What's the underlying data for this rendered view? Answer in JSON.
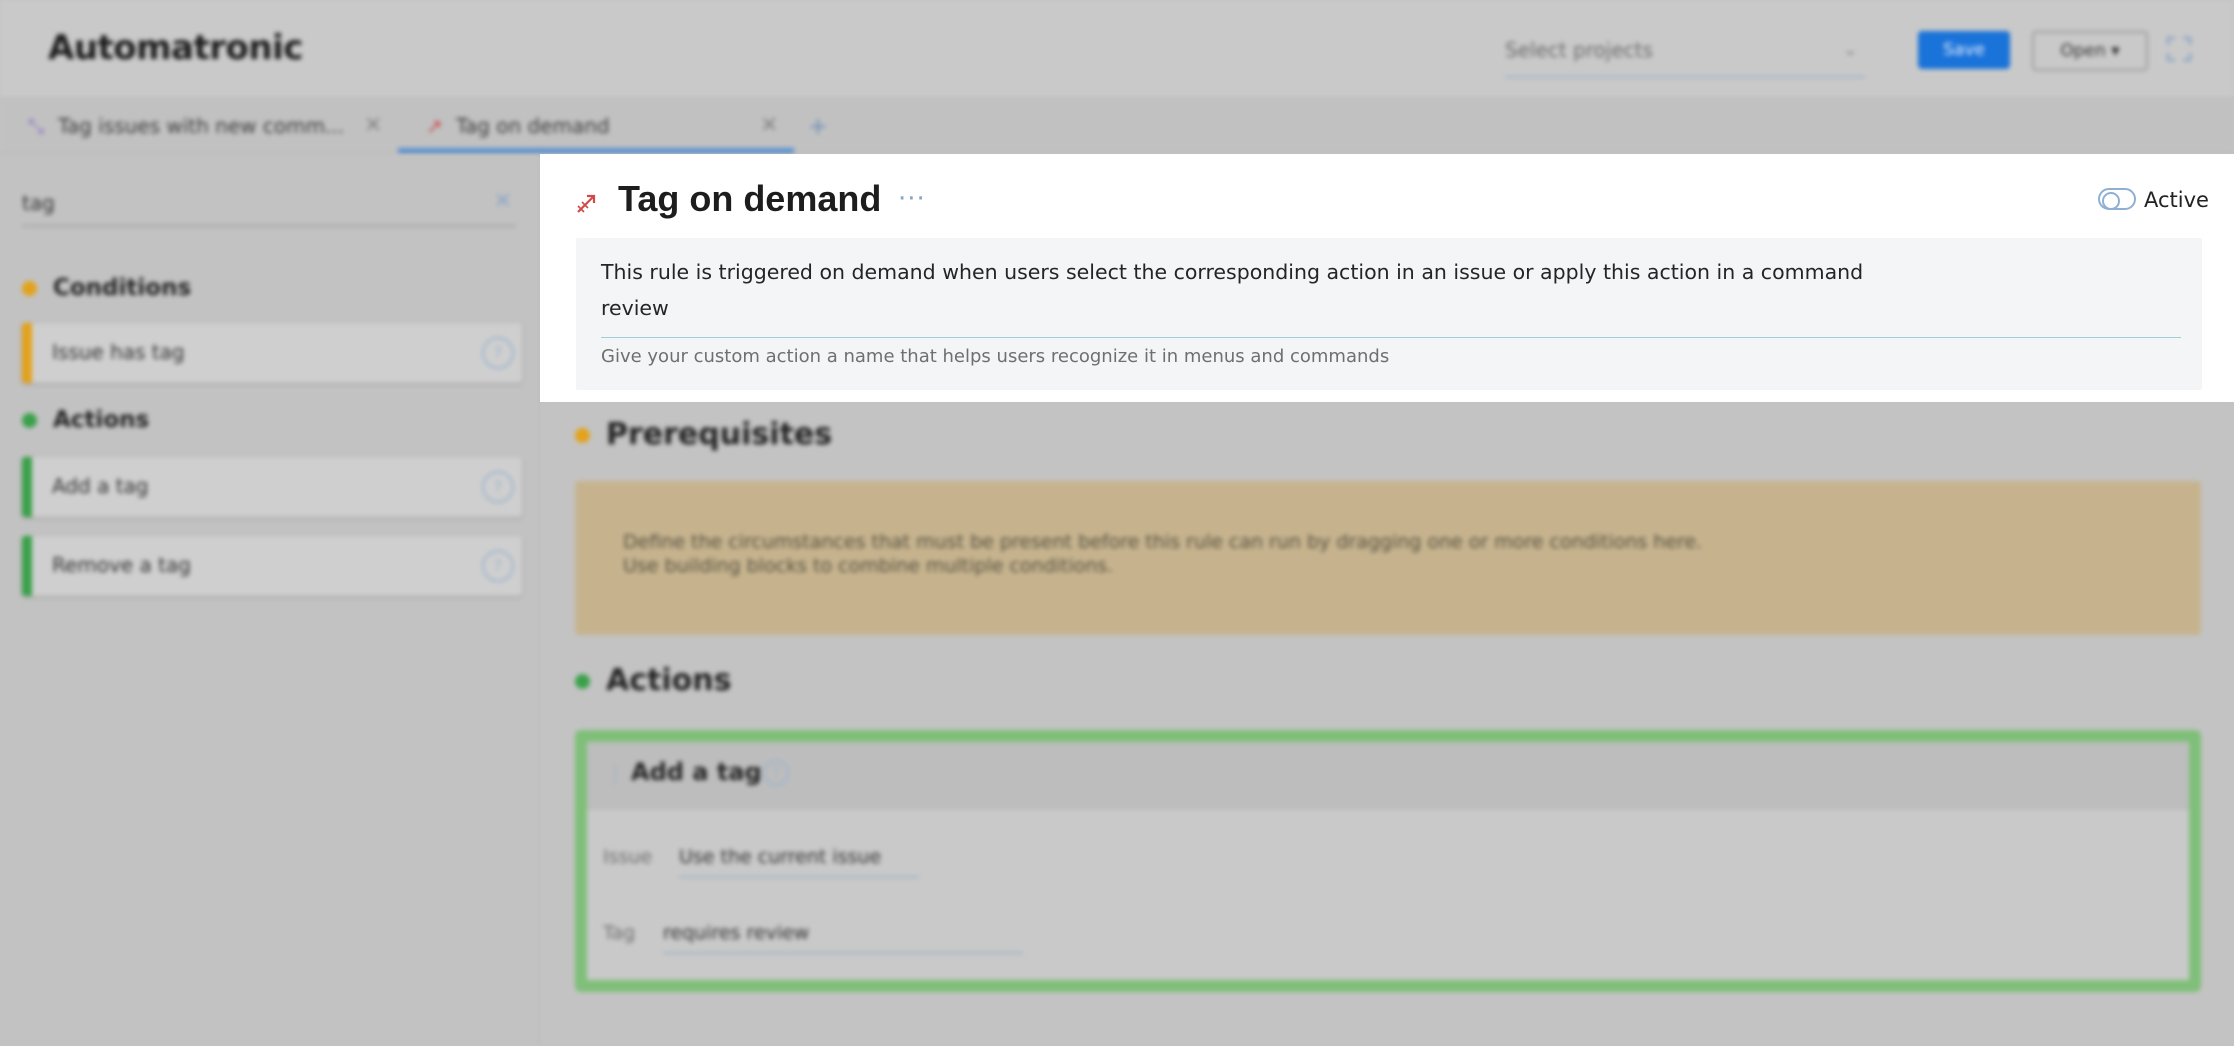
{
  "header": {
    "app_title": "Automatronic",
    "project_placeholder": "Select projects",
    "save_label": "Save",
    "open_label": "Open ▾"
  },
  "tabs": [
    {
      "label": "Tag issues with new comm...",
      "icon": "rule-icon-purple"
    },
    {
      "label": "Tag on demand",
      "icon": "rule-icon-red",
      "active": true
    }
  ],
  "sidebar": {
    "search_value": "tag",
    "sections": [
      {
        "title": "Conditions",
        "color": "#e3a21a",
        "items": [
          "Issue has tag"
        ]
      },
      {
        "title": "Actions",
        "color": "#3aa14a",
        "items": [
          "Add a tag",
          "Remove a tag"
        ]
      }
    ]
  },
  "main": {
    "prerequisites_title": "Prerequisites",
    "prerequisites_text_1": "Define the circumstances that must be present before this rule can run by dragging one or more conditions here.",
    "prerequisites_text_2": "Use building blocks to combine multiple conditions.",
    "actions_title": "Actions",
    "action_block": {
      "title": "Add a tag",
      "issue_label": "Issue",
      "issue_value": "Use the current issue",
      "tag_label": "Tag",
      "tag_value": "requires review"
    }
  },
  "rule": {
    "title": "Tag on demand",
    "active_label": "Active",
    "description": "This rule is triggered on demand when users select the corresponding action in an issue or apply this action in a command",
    "action_name": "review",
    "hint": "Give your custom action a name that helps users recognize it in menus and commands"
  },
  "colors": {
    "accent": "#1a73d9",
    "conditions": "#e3a21a",
    "actions": "#3aa14a",
    "prereq_bg": "#c6b38e"
  }
}
